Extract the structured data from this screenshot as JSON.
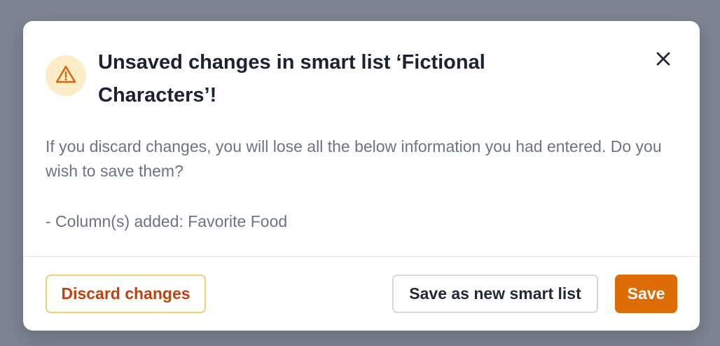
{
  "dialog": {
    "title": "Unsaved changes in smart list ‘Fictional Characters’!",
    "message": "If you discard changes, you will lose all the below information you had entered. Do you wish to save them?",
    "changes": [
      "- Column(s) added: Favorite Food"
    ],
    "icon": "warning-triangle-icon",
    "close_icon": "close-icon"
  },
  "actions": {
    "discard_label": "Discard changes",
    "save_as_new_label": "Save as new smart list",
    "save_label": "Save"
  },
  "colors": {
    "backdrop": "#7d8492",
    "warning_bg": "#fdecc8",
    "warning_icon": "#d9650a",
    "primary": "#dd6b06",
    "discard_text": "#c2410c",
    "discard_border": "#f4cf7a"
  }
}
